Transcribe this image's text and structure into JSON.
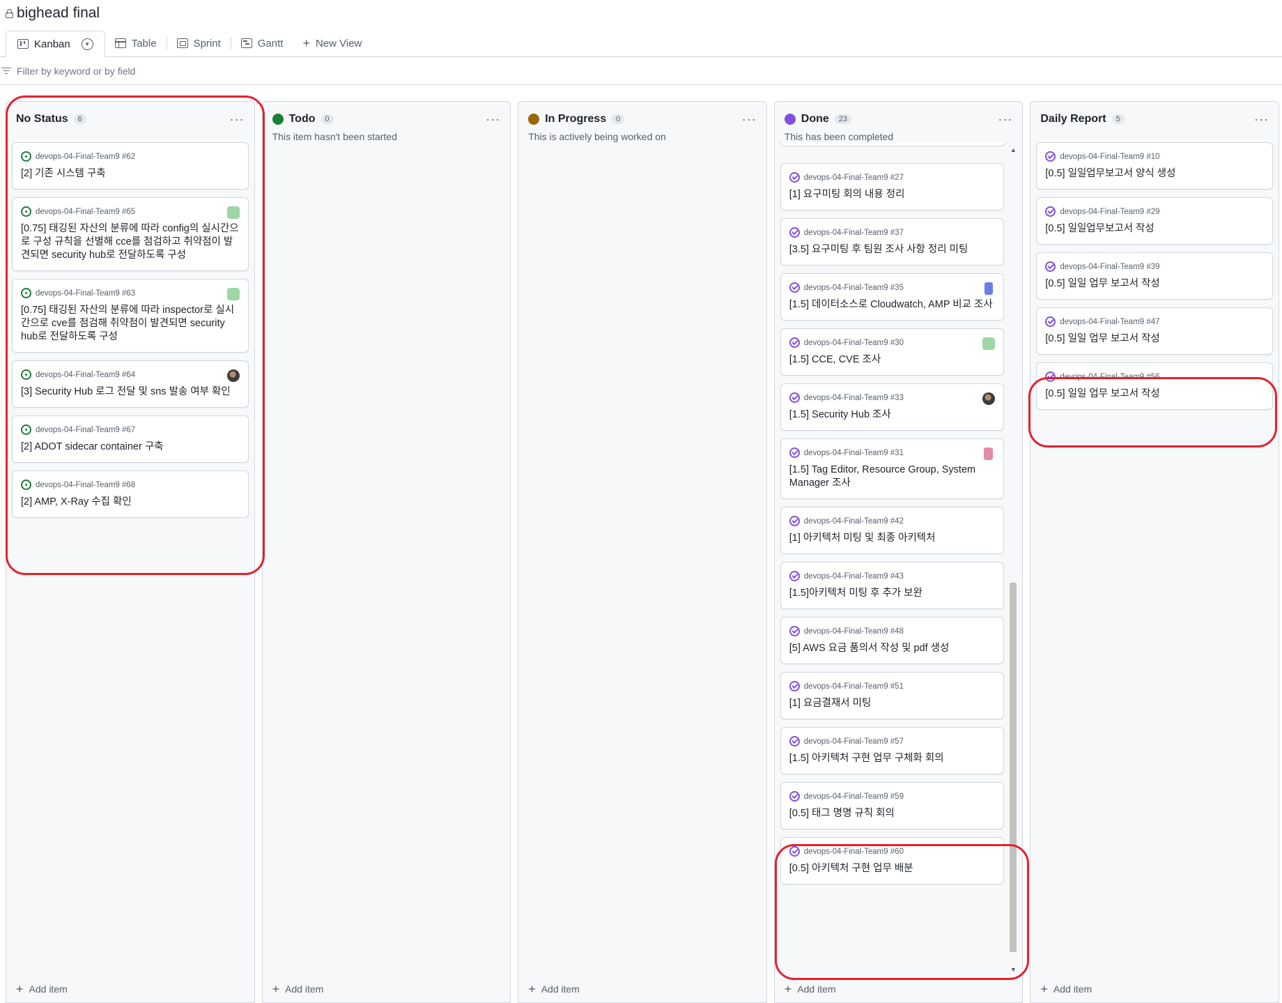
{
  "project": {
    "title": "bighead final"
  },
  "tabs": [
    {
      "label": "Kanban",
      "icon": "kanban-icon",
      "active": true
    },
    {
      "label": "Table",
      "icon": "table-icon"
    },
    {
      "label": "Sprint",
      "icon": "sprint-icon"
    },
    {
      "label": "Gantt",
      "icon": "gantt-icon"
    }
  ],
  "new_view_label": "New View",
  "filter": {
    "placeholder": "Filter by keyword or by field"
  },
  "add_item_label": "Add item",
  "columns": [
    {
      "name": "No Status",
      "count": "6",
      "dot_color": "",
      "description": "",
      "cards": [
        {
          "repo": "devops-04-Final-Team9 #62",
          "title": "[2] 기존 시스템 구축",
          "status": "open",
          "badge": ""
        },
        {
          "repo": "devops-04-Final-Team9 #65",
          "title": "[0.75] 태깅된 자산의 분류에 따라 config의 실시간으로 구성 규칙을 선별해 cce를 점검하고 취약점이 발견되면 security hub로 전달하도록 구성",
          "status": "open",
          "badge": "green"
        },
        {
          "repo": "devops-04-Final-Team9 #63",
          "title": "[0.75] 태깅된 자산의 분류에 따라 inspector로 실시간으로 cve를 점검해 취약점이 발견되면 security hub로 전달하도록 구성",
          "status": "open",
          "badge": "green"
        },
        {
          "repo": "devops-04-Final-Team9 #64",
          "title": "[3] Security Hub 로그 전달 및 sns 발송 여부 확인",
          "status": "open",
          "badge": "avatar"
        },
        {
          "repo": "devops-04-Final-Team9 #67",
          "title": "[2] ADOT sidecar container 구축",
          "status": "open",
          "badge": ""
        },
        {
          "repo": "devops-04-Final-Team9 #68",
          "title": "[2] AMP, X-Ray 수집 확인",
          "status": "open",
          "badge": ""
        }
      ]
    },
    {
      "name": "Todo",
      "count": "0",
      "dot_color": "#1a7f37",
      "description": "This item hasn't been started",
      "cards": []
    },
    {
      "name": "In Progress",
      "count": "0",
      "dot_color": "#9a6700",
      "description": "This is actively being worked on",
      "cards": []
    },
    {
      "name": "Done",
      "count": "23",
      "dot_color": "#8250df",
      "description": "This has been completed",
      "cards": [
        {
          "repo": "devops-04-Final-Team9 #27",
          "title": "[1] 요구미팅 회의 내용 정리",
          "status": "done",
          "badge": ""
        },
        {
          "repo": "devops-04-Final-Team9 #37",
          "title": "[3.5] 요구미팅 후 팀원 조사 사항 정리 미팅",
          "status": "done",
          "badge": ""
        },
        {
          "repo": "devops-04-Final-Team9 #35",
          "title": "[1.5] 데이터소스로 Cloudwatch, AMP 비교 조사",
          "status": "done",
          "badge": "blue"
        },
        {
          "repo": "devops-04-Final-Team9 #30",
          "title": "[1.5] CCE, CVE 조사",
          "status": "done",
          "badge": "green"
        },
        {
          "repo": "devops-04-Final-Team9 #33",
          "title": "[1.5] Security Hub 조사",
          "status": "done",
          "badge": "avatar"
        },
        {
          "repo": "devops-04-Final-Team9 #31",
          "title": "[1.5] Tag Editor, Resource Group, System Manager 조사",
          "status": "done",
          "badge": "pink"
        },
        {
          "repo": "devops-04-Final-Team9 #42",
          "title": "[1] 아키텍처 미팅 및 최종 아키텍처",
          "status": "done",
          "badge": ""
        },
        {
          "repo": "devops-04-Final-Team9 #43",
          "title": "[1.5]아키텍처 미팅 후 추가 보완",
          "status": "done",
          "badge": ""
        },
        {
          "repo": "devops-04-Final-Team9 #48",
          "title": "[5] AWS 요금 품의서 작성 및 pdf 생성",
          "status": "done",
          "badge": ""
        },
        {
          "repo": "devops-04-Final-Team9 #51",
          "title": "[1] 요금결재서 미팅",
          "status": "done",
          "badge": ""
        },
        {
          "repo": "devops-04-Final-Team9 #57",
          "title": "[1.5] 아키텍처 구현 업무 구체화 회의",
          "status": "done",
          "badge": ""
        },
        {
          "repo": "devops-04-Final-Team9 #59",
          "title": "[0.5] 태그 명명 규칙 회의",
          "status": "done",
          "badge": ""
        },
        {
          "repo": "devops-04-Final-Team9 #60",
          "title": "[0.5] 아키텍처 구현 업무 배분",
          "status": "done",
          "badge": ""
        }
      ]
    },
    {
      "name": "Daily Report",
      "count": "5",
      "dot_color": "",
      "description": "",
      "cards": [
        {
          "repo": "devops-04-Final-Team9 #10",
          "title": "[0.5] 일일업무보고서 양식 생성",
          "status": "done",
          "badge": ""
        },
        {
          "repo": "devops-04-Final-Team9 #29",
          "title": "[0.5] 일일업무보고서 작성",
          "status": "done",
          "badge": ""
        },
        {
          "repo": "devops-04-Final-Team9 #39",
          "title": "[0.5] 일일 업무 보고서 작성",
          "status": "done",
          "badge": ""
        },
        {
          "repo": "devops-04-Final-Team9 #47",
          "title": "[0.5] 일일 업무 보고서 작성",
          "status": "done",
          "badge": ""
        },
        {
          "repo": "devops-04-Final-Team9 #56",
          "title": "[0.5] 일일 업무 보고서 작성",
          "status": "done",
          "badge": ""
        }
      ]
    }
  ]
}
